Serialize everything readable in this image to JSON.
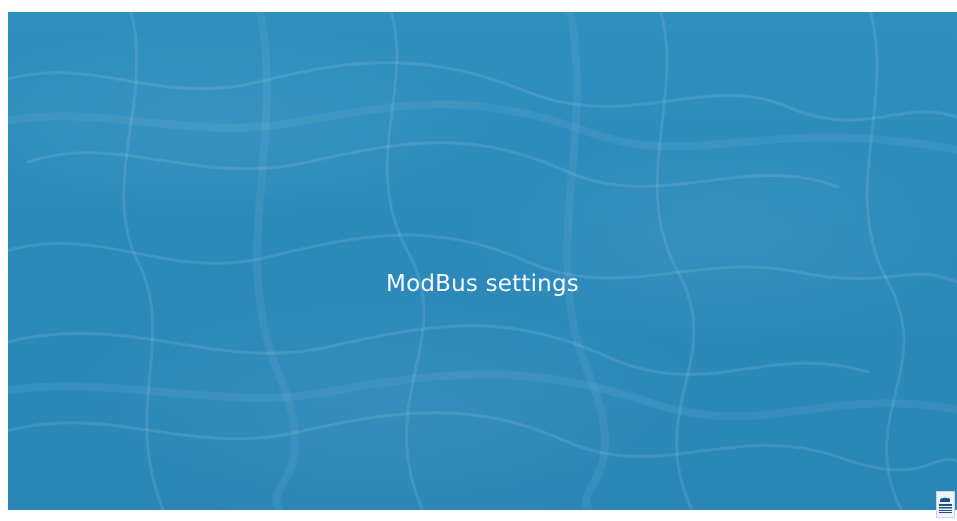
{
  "slide": {
    "title": "ModBus settings",
    "background_color": "#2c8abb",
    "title_color": "#f4fbff"
  },
  "brand_logo": {
    "icon": "company-logo-icon",
    "color": "#1d4f86"
  }
}
